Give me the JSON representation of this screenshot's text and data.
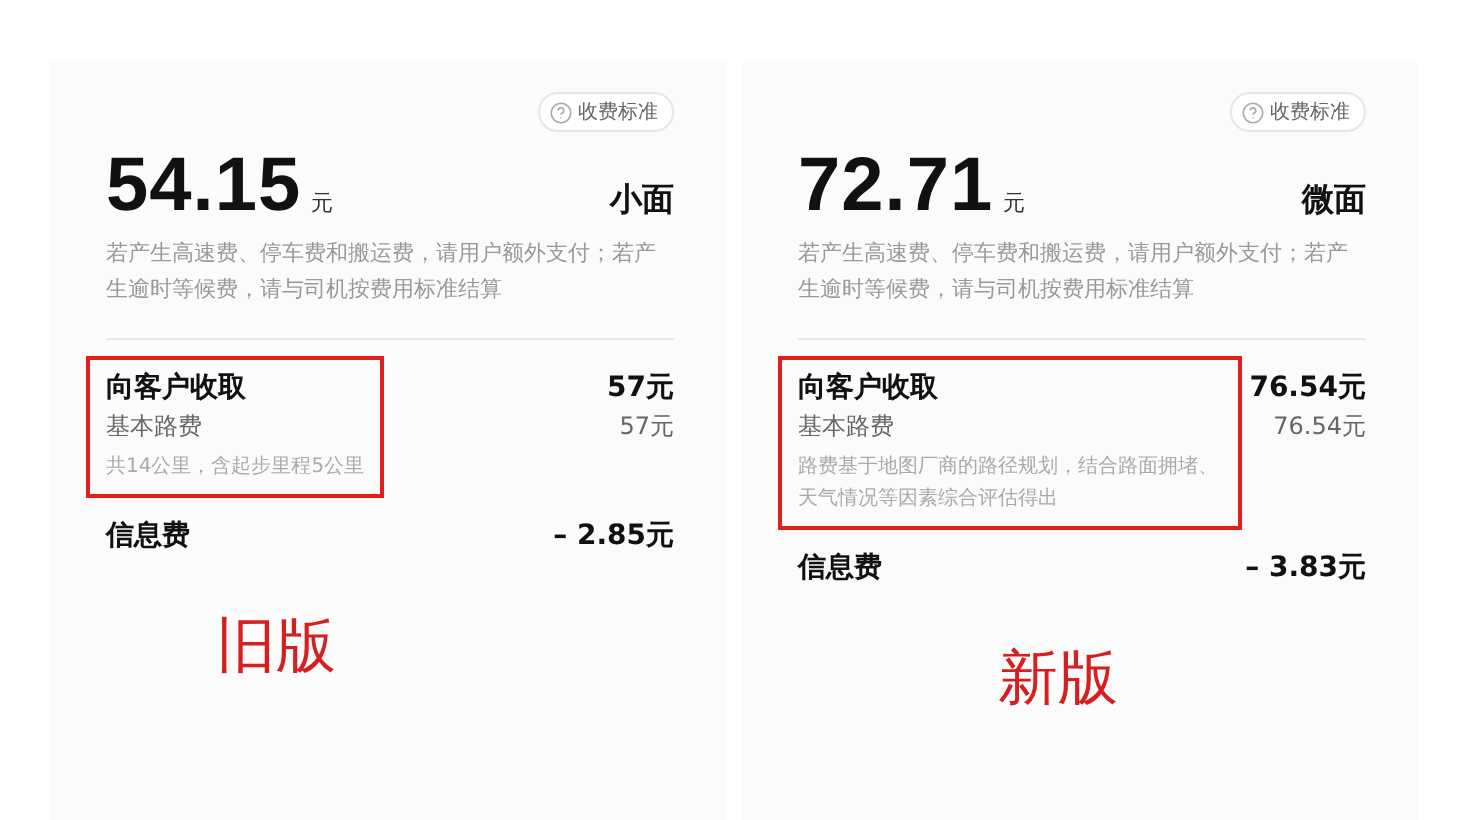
{
  "panels": [
    {
      "fee_standard_button": "收费标准",
      "price": "54.15",
      "unit": "元",
      "vehicle": "小面",
      "note": "若产生高速费、停车费和搬运费，请用户额外支付；若产生逾时等候费，请与司机按费用标准结算",
      "charge": {
        "title": "向客户收取",
        "amount": "57元",
        "item": "基本路费",
        "item_amount": "57元",
        "detail": "共14公里，含起步里程5公里"
      },
      "info_fee": {
        "label": "信息费",
        "amount": "– 2.85元"
      },
      "annotation": "旧版"
    },
    {
      "fee_standard_button": "收费标准",
      "price": "72.71",
      "unit": "元",
      "vehicle": "微面",
      "note": "若产生高速费、停车费和搬运费，请用户额外支付；若产生逾时等候费，请与司机按费用标准结算",
      "charge": {
        "title": "向客户收取",
        "amount": "76.54元",
        "item": "基本路费",
        "item_amount": "76.54元",
        "detail": "路费基于地图厂商的路径规划，结合路面拥堵、天气情况等因素综合评估得出"
      },
      "info_fee": {
        "label": "信息费",
        "amount": "– 3.83元"
      },
      "annotation": "新版"
    }
  ]
}
